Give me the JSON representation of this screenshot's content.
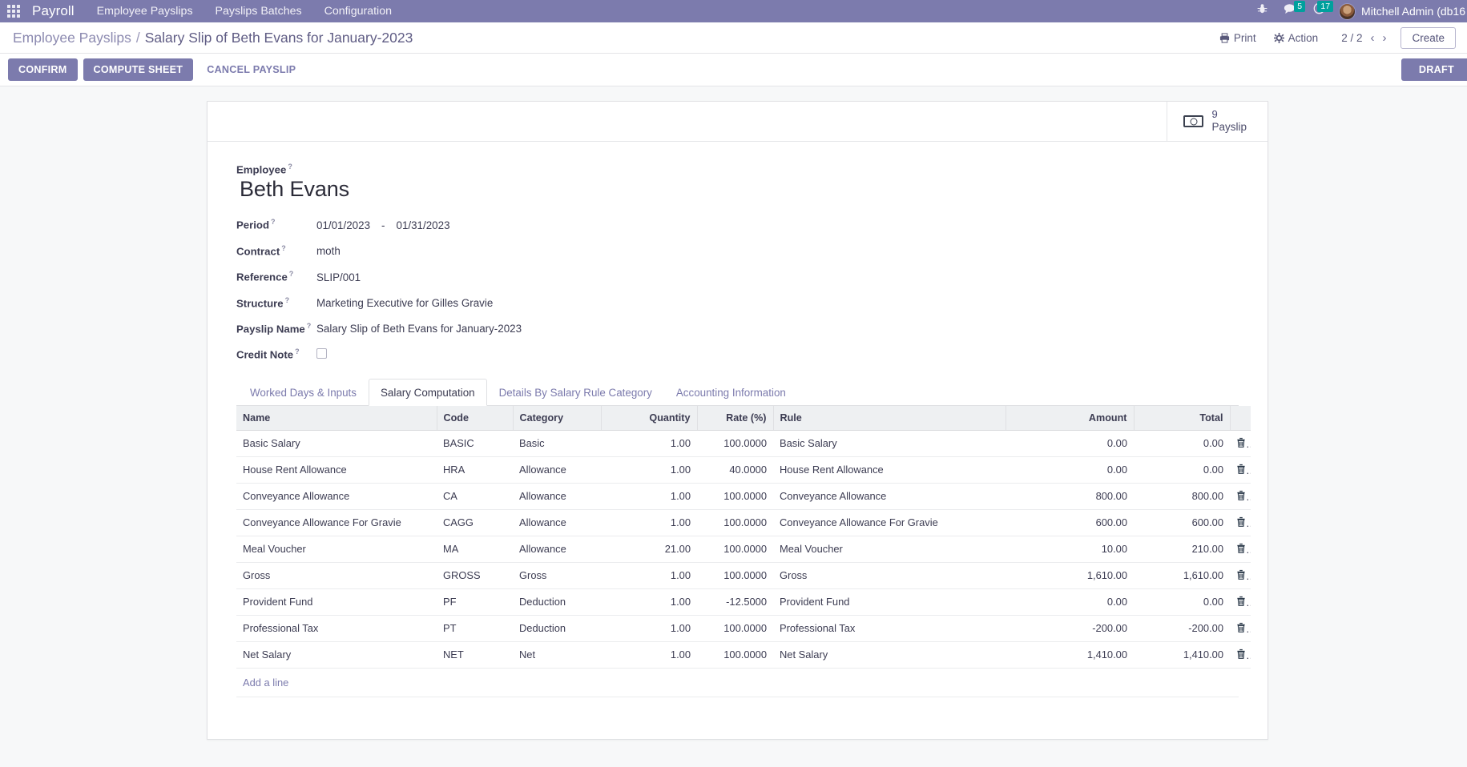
{
  "navbar": {
    "apps_icon": "apps-grid-icon",
    "brand": "Payroll",
    "menus": [
      "Employee Payslips",
      "Payslips Batches",
      "Configuration"
    ],
    "icons": [
      {
        "name": "bug-icon",
        "glyph": "☣",
        "badge": null
      },
      {
        "name": "messages-icon",
        "glyph": "●",
        "badge": "5"
      },
      {
        "name": "activities-clock-icon",
        "glyph": "◔",
        "badge": "17"
      }
    ],
    "user": "Mitchell Admin (db16",
    "accent": "#7c7bad"
  },
  "control_panel": {
    "breadcrumb_parent": "Employee Payslips",
    "breadcrumb_sep": "/",
    "breadcrumb_current": "Salary Slip of Beth Evans for January-2023",
    "print_label": "Print",
    "action_label": "Action",
    "pager": "2 / 2",
    "prev_glyph": "‹",
    "next_glyph": "›",
    "create_label": "Create"
  },
  "statusbar": {
    "confirm_label": "CONFIRM",
    "compute_label": "COMPUTE SHEET",
    "cancel_label": "CANCEL PAYSLIP",
    "state_label": "DRAFT"
  },
  "smart_button": {
    "icon": "money-bill-icon",
    "value": "9",
    "label": "Payslip"
  },
  "form": {
    "employee_label": "Employee",
    "employee_value": "Beth Evans",
    "period_label": "Period",
    "period_from": "01/01/2023",
    "period_dash": "-",
    "period_to": "01/31/2023",
    "contract_label": "Contract",
    "contract_value": "moth",
    "reference_label": "Reference",
    "reference_value": "SLIP/001",
    "structure_label": "Structure",
    "structure_value": "Marketing Executive for Gilles Gravie",
    "payslip_name_label": "Payslip Name",
    "payslip_name_value": "Salary Slip of Beth Evans for January-2023",
    "credit_note_label": "Credit Note",
    "credit_note_checked": false,
    "help_marker": "?"
  },
  "tabs": [
    {
      "label": "Worked Days & Inputs",
      "active": false
    },
    {
      "label": "Salary Computation",
      "active": true
    },
    {
      "label": "Details By Salary Rule Category",
      "active": false
    },
    {
      "label": "Accounting Information",
      "active": false
    }
  ],
  "table": {
    "columns": [
      "Name",
      "Code",
      "Category",
      "Quantity",
      "Rate (%)",
      "Rule",
      "Amount",
      "Total"
    ],
    "rows": [
      {
        "name": "Basic Salary",
        "code": "BASIC",
        "category": "Basic",
        "quantity": "1.00",
        "rate": "100.0000",
        "rule": "Basic Salary",
        "amount": "0.00",
        "total": "0.00",
        "highlight": true
      },
      {
        "name": "House Rent Allowance",
        "code": "HRA",
        "category": "Allowance",
        "quantity": "1.00",
        "rate": "40.0000",
        "rule": "House Rent Allowance",
        "amount": "0.00",
        "total": "0.00",
        "highlight": true
      },
      {
        "name": "Conveyance Allowance",
        "code": "CA",
        "category": "Allowance",
        "quantity": "1.00",
        "rate": "100.0000",
        "rule": "Conveyance Allowance",
        "amount": "800.00",
        "total": "800.00",
        "highlight": false
      },
      {
        "name": "Conveyance Allowance For Gravie",
        "code": "CAGG",
        "category": "Allowance",
        "quantity": "1.00",
        "rate": "100.0000",
        "rule": "Conveyance Allowance For Gravie",
        "amount": "600.00",
        "total": "600.00",
        "highlight": false
      },
      {
        "name": "Meal Voucher",
        "code": "MA",
        "category": "Allowance",
        "quantity": "21.00",
        "rate": "100.0000",
        "rule": "Meal Voucher",
        "amount": "10.00",
        "total": "210.00",
        "highlight": false
      },
      {
        "name": "Gross",
        "code": "GROSS",
        "category": "Gross",
        "quantity": "1.00",
        "rate": "100.0000",
        "rule": "Gross",
        "amount": "1,610.00",
        "total": "1,610.00",
        "highlight": false
      },
      {
        "name": "Provident Fund",
        "code": "PF",
        "category": "Deduction",
        "quantity": "1.00",
        "rate": "-12.5000",
        "rule": "Provident Fund",
        "amount": "0.00",
        "total": "0.00",
        "highlight": true
      },
      {
        "name": "Professional Tax",
        "code": "PT",
        "category": "Deduction",
        "quantity": "1.00",
        "rate": "100.0000",
        "rule": "Professional Tax",
        "amount": "-200.00",
        "total": "-200.00",
        "highlight": false
      },
      {
        "name": "Net Salary",
        "code": "NET",
        "category": "Net",
        "quantity": "1.00",
        "rate": "100.0000",
        "rule": "Net Salary",
        "amount": "1,410.00",
        "total": "1,410.00",
        "highlight": false
      }
    ],
    "add_line_label": "Add a line",
    "delete_icon": "trash-icon"
  }
}
